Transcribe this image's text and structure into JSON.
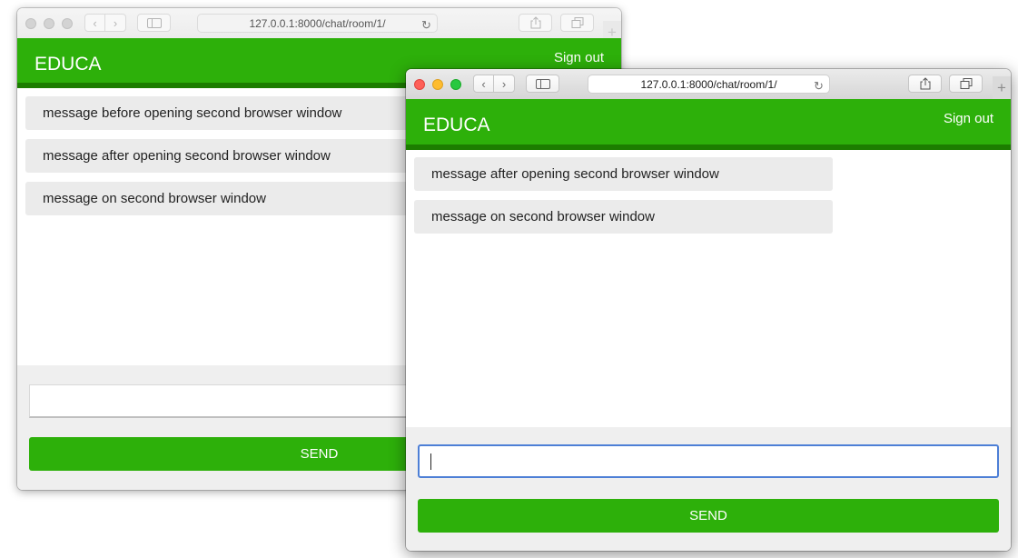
{
  "colors": {
    "brand_green": "#2db00a",
    "brand_green_dark": "#1c7d00",
    "message_bg": "#ebebeb",
    "focus_blue": "#4d7fd6"
  },
  "back_window": {
    "address_url": "127.0.0.1:8000/chat/room/1/",
    "logo": "EDUCA",
    "sign_out": "Sign out",
    "messages": [
      "message before opening second browser window",
      "message after opening second browser window",
      "message on second browser window"
    ],
    "input_value": "",
    "send_label": "SEND"
  },
  "front_window": {
    "address_url": "127.0.0.1:8000/chat/room/1/",
    "logo": "EDUCA",
    "sign_out": "Sign out",
    "messages": [
      "message after opening second browser window",
      "message on second browser window"
    ],
    "input_value": "",
    "send_label": "SEND"
  },
  "icons": {
    "back": "chevron-left-icon",
    "forward": "chevron-right-icon",
    "sidebar": "sidebar-icon",
    "reload": "reload-icon",
    "share": "share-icon",
    "tabs": "tabs-icon",
    "new_tab": "plus-icon"
  }
}
